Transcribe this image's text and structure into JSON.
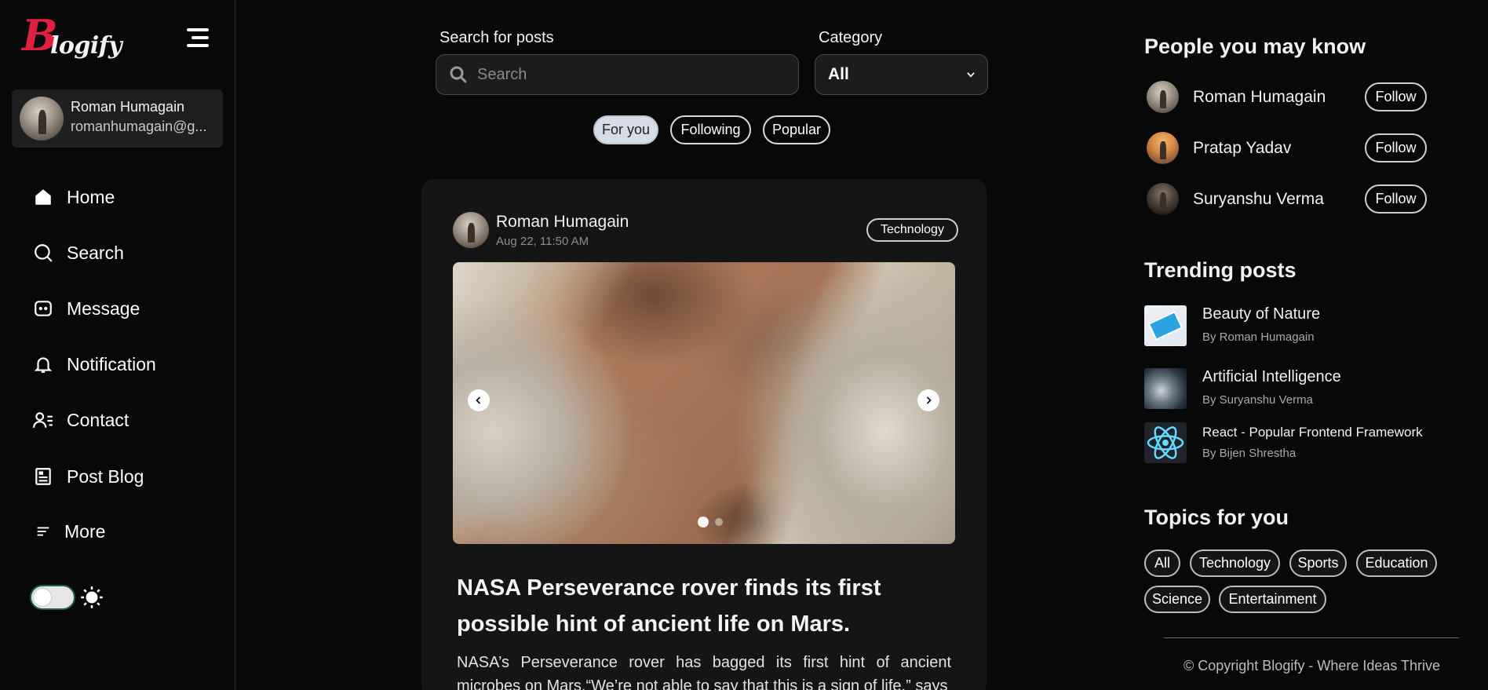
{
  "sidebar": {
    "logo": {
      "first_letter": "B",
      "rest": "logify"
    },
    "profile": {
      "name": "Roman Humagain",
      "email": "romanhumagain@g..."
    },
    "nav": [
      {
        "label": "Home",
        "icon": "home-icon"
      },
      {
        "label": "Search",
        "icon": "search-icon"
      },
      {
        "label": "Message",
        "icon": "message-icon"
      },
      {
        "label": "Notification",
        "icon": "bell-icon"
      },
      {
        "label": "Contact",
        "icon": "contact-icon"
      },
      {
        "label": "Post Blog",
        "icon": "document-icon"
      },
      {
        "label": "More",
        "icon": "menu-lines-icon"
      }
    ],
    "theme_toggle": {
      "icon": "sun-icon",
      "state": "light-off"
    }
  },
  "search": {
    "label": "Search for posts",
    "placeholder": "Search"
  },
  "category": {
    "label": "Category",
    "selected": "All"
  },
  "feed_tabs": [
    {
      "label": "For you",
      "active": true
    },
    {
      "label": "Following",
      "active": false
    },
    {
      "label": "Popular",
      "active": false
    }
  ],
  "post": {
    "author": "Roman Humagain",
    "date": "Aug 22, 11:50 AM",
    "tag": "Technology",
    "image_alt": "Mars rock surface",
    "title": "NASA Perseverance rover finds its first possible hint of ancient life on Mars.",
    "excerpt": "NASA’s Perseverance rover has bagged its first hint of ancient microbes on Mars.“We’re not able to say that this is a sign of life,” says"
  },
  "people": {
    "heading": "People you may know",
    "list": [
      {
        "name": "Roman Humagain",
        "action": "Follow"
      },
      {
        "name": "Pratap Yadav",
        "action": "Follow"
      },
      {
        "name": "Suryanshu Verma",
        "action": "Follow"
      }
    ]
  },
  "trending": {
    "heading": "Trending posts",
    "list": [
      {
        "title": "Beauty of Nature",
        "by": "By Roman Humagain"
      },
      {
        "title": "Artificial Intelligence",
        "by": "By Suryanshu Verma"
      },
      {
        "title": "React - Popular Frontend Framework",
        "by": "By Bijen Shrestha"
      }
    ]
  },
  "topics": {
    "heading": "Topics for you",
    "list": [
      "All",
      "Technology",
      "Sports",
      "Education",
      "Science",
      "Entertainment"
    ]
  },
  "footer": {
    "copyright": "© Copyright Blogify - Where Ideas Thrive"
  },
  "colors": {
    "brand": "#e0203f",
    "background": "#080808",
    "card": "#151515",
    "active_pill": "#d7dde6"
  }
}
